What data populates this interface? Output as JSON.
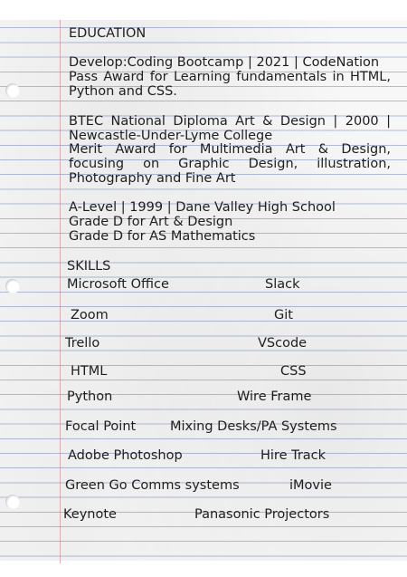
{
  "education": {
    "heading": "EDUCATION",
    "bootcamp": {
      "title": "Develop:Coding Bootcamp | 2021 | CodeNation",
      "detail": "Pass Award for Learning fundamentals in HTML, Python and CSS."
    },
    "btec": {
      "title_line1": "BTEC National Diploma Art & Design | 2000 |",
      "title_line2": "Newcastle-Under-Lyme College",
      "detail": "Merit Award for Multimedia Art & Design, focusing on Graphic Design, illustration, Photography and Fine Art"
    },
    "alevel": {
      "title": "A-Level | 1999 | Dane Valley High School",
      "grade1": "Grade D for Art & Design",
      "grade2": "Grade D for AS Mathematics"
    }
  },
  "skills": {
    "heading": "SKILLS",
    "items": [
      "Microsoft Office",
      "Slack",
      "Zoom",
      "Git",
      "Trello",
      "VScode",
      "HTML",
      "CSS",
      "Python",
      "Wire Frame",
      "Focal Point",
      "Mixing Desks/PA Systems",
      "Adobe Photoshop",
      "Hire Track",
      "Green Go Comms systems",
      "iMovie",
      "Keynote",
      "Panasonic Projectors"
    ]
  }
}
